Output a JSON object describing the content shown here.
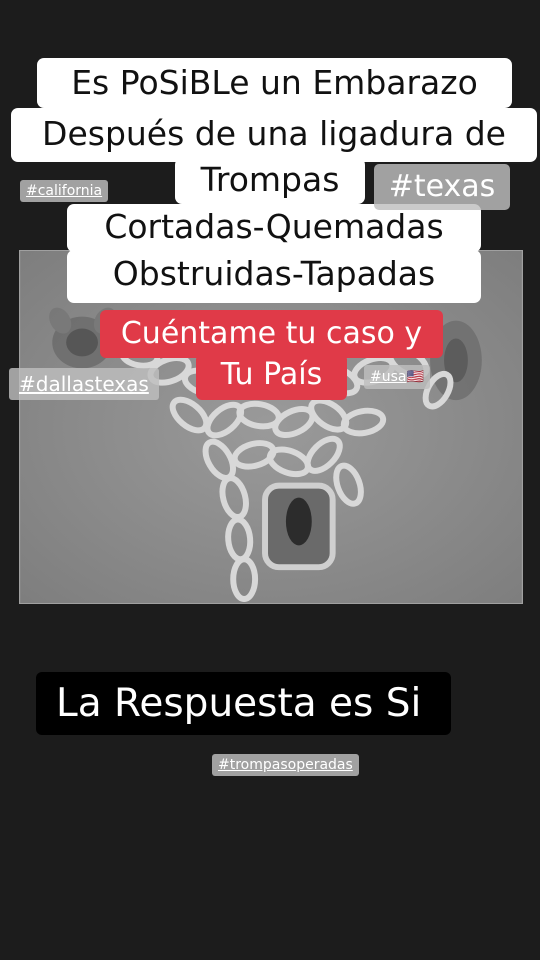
{
  "headline": {
    "line1": "Es PoSiBLe un Embarazo",
    "line2": "Después de una ligadura de",
    "line3": "Trompas",
    "line4": "Cortadas-Quemadas",
    "line5": "Obstruidas-Tapadas"
  },
  "cta": {
    "line1": "Cuéntame tu caso y",
    "line2": "Tu País"
  },
  "answer": "La Respuesta es Si",
  "hashtags": {
    "california": "#california",
    "texas": "#texas",
    "dallastexas": "#dallastexas",
    "usa": "#usa",
    "usa_flag": "🇺🇸",
    "trompasoperadas": "#trompasoperadas"
  },
  "colors": {
    "background": "#1c1c1c",
    "caption_bg": "#ffffff",
    "cta_bg": "#e03a48",
    "answer_bg": "#000000"
  },
  "image": {
    "subject": "chained-uterus-illustration",
    "style": "grayscale"
  }
}
